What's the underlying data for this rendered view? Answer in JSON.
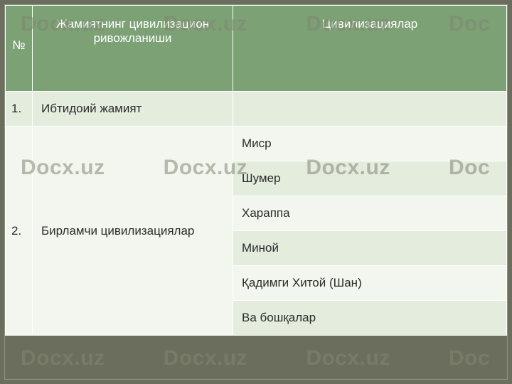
{
  "watermark": "Docx.uz",
  "watermark_tail": "Doc",
  "header": {
    "num": "№",
    "left": "Жамиятнинг цивилизацион ривожланиши",
    "right": "Цивилизациялар"
  },
  "rows": {
    "r1": {
      "num": "1.",
      "left": "Ибтидоий жамият",
      "right": ""
    },
    "r2": {
      "num": "2.",
      "left": "Бирламчи цивилизациялар",
      "rights": {
        "a": "Миср",
        "b": "Шумер",
        "c": "Хараппа",
        "d": "Миной",
        "e": "Қадимги Хитой (Шан)",
        "f": "Ва бошқалар"
      }
    }
  }
}
